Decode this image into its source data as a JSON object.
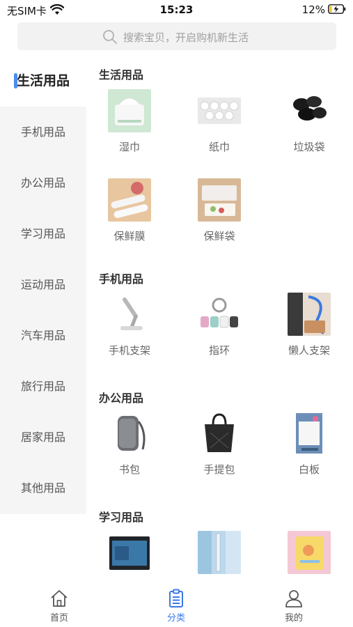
{
  "status_bar": {
    "carrier": "无SIM卡",
    "time": "15:23",
    "battery_percent": "12%"
  },
  "search": {
    "placeholder": "搜索宝贝，开启购机新生活"
  },
  "sidebar": {
    "active_color": "#4a8ef0",
    "items": [
      {
        "label": "生活用品",
        "active": true
      },
      {
        "label": "手机用品"
      },
      {
        "label": "办公用品"
      },
      {
        "label": "学习用品"
      },
      {
        "label": "运动用品"
      },
      {
        "label": "汽车用品"
      },
      {
        "label": "旅行用品"
      },
      {
        "label": "居家用品"
      },
      {
        "label": "其他用品"
      }
    ]
  },
  "sections": [
    {
      "title": "生活用品",
      "products": [
        {
          "name": "湿巾",
          "icon": "wet-wipes-icon"
        },
        {
          "name": "纸巾",
          "icon": "tissue-icon"
        },
        {
          "name": "垃圾袋",
          "icon": "trash-bag-icon"
        },
        {
          "name": "保鲜膜",
          "icon": "cling-film-icon"
        },
        {
          "name": "保鲜袋",
          "icon": "freshness-bag-icon"
        }
      ]
    },
    {
      "title": "手机用品",
      "products": [
        {
          "name": "手机支架",
          "icon": "phone-stand-icon"
        },
        {
          "name": "指环",
          "icon": "ring-holder-icon"
        },
        {
          "name": "懒人支架",
          "icon": "lazy-stand-icon"
        }
      ]
    },
    {
      "title": "办公用品",
      "products": [
        {
          "name": "书包",
          "icon": "backpack-icon"
        },
        {
          "name": "手提包",
          "icon": "handbag-icon"
        },
        {
          "name": "白板",
          "icon": "whiteboard-icon"
        }
      ]
    },
    {
      "title": "学习用品",
      "products": [
        {
          "name": "",
          "icon": "tablet-icon"
        },
        {
          "name": "",
          "icon": "pen-icon"
        },
        {
          "name": "",
          "icon": "notebook-icon"
        }
      ]
    }
  ],
  "tabbar": {
    "active_color": "#3a78e8",
    "tabs": [
      {
        "label": "首页",
        "icon": "home-icon"
      },
      {
        "label": "分类",
        "icon": "category-icon",
        "active": true
      },
      {
        "label": "我的",
        "icon": "profile-icon"
      }
    ]
  }
}
